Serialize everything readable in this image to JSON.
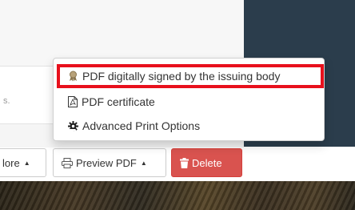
{
  "card": {
    "snippet_text": "s."
  },
  "buttons": {
    "more_label": "lore",
    "preview_label": "Preview PDF",
    "delete_label": "Delete"
  },
  "dropdown": {
    "items": [
      {
        "label": "PDF digitally signed by the issuing body",
        "icon": "award-ribbon-icon"
      },
      {
        "label": "PDF certificate",
        "icon": "pdf-file-icon"
      },
      {
        "label": "Advanced Print Options",
        "icon": "gear-icon"
      }
    ]
  },
  "colors": {
    "highlight": "#e8101c",
    "delete_button": "#d9534f",
    "dark_panel": "#2b3d4c"
  }
}
